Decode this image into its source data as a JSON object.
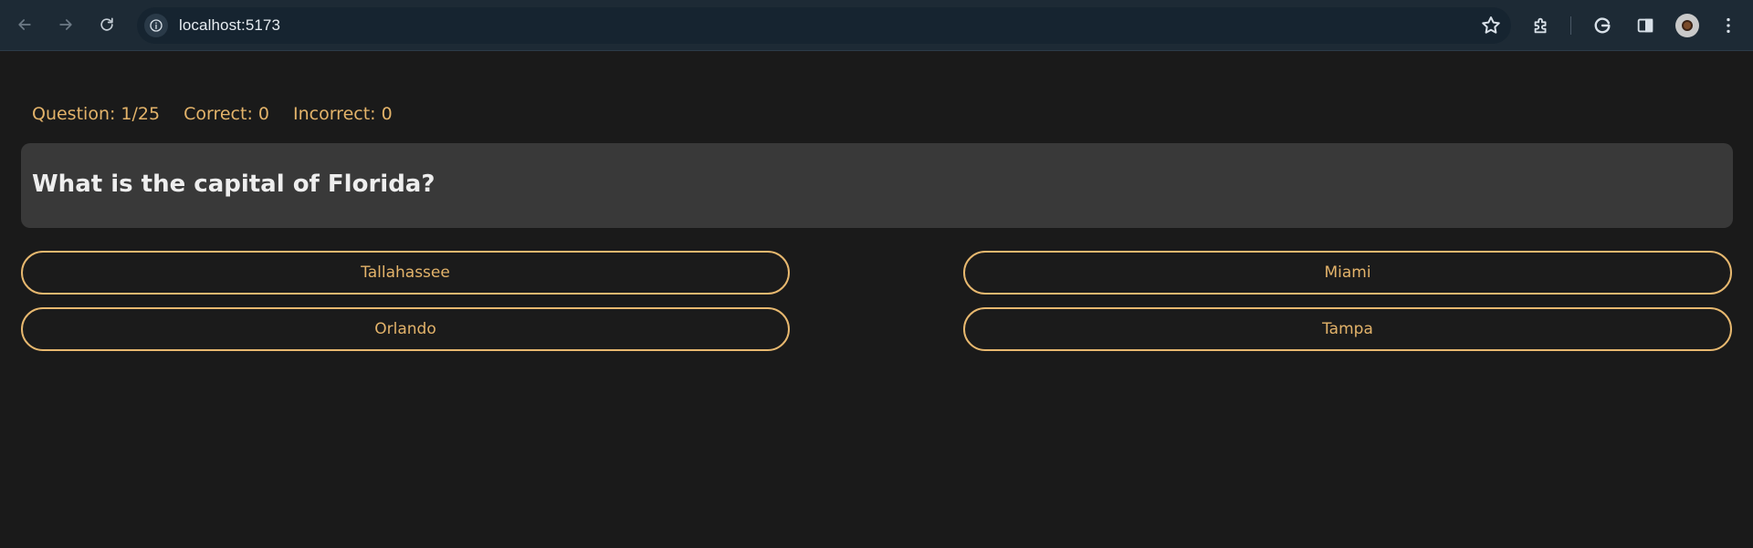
{
  "browser": {
    "url": "localhost:5173",
    "icons": [
      "back-icon",
      "forward-icon",
      "reload-icon",
      "site-info-icon",
      "bookmark-star-icon",
      "extensions-icon",
      "google-icon",
      "side-panel-icon",
      "profile-avatar",
      "menu-icon"
    ]
  },
  "stats": {
    "question": "Question: 1/25",
    "correct": "Correct: 0",
    "incorrect": "Incorrect: 0"
  },
  "question": {
    "text": "What is the capital of Florida?"
  },
  "answers": [
    {
      "label": "Tallahassee"
    },
    {
      "label": "Miami"
    },
    {
      "label": "Orlando"
    },
    {
      "label": "Tampa"
    }
  ],
  "colors": {
    "background": "#1a1a1a",
    "accent": "#e3b36a",
    "card": "#393939",
    "chrome": "#1d2a35"
  }
}
